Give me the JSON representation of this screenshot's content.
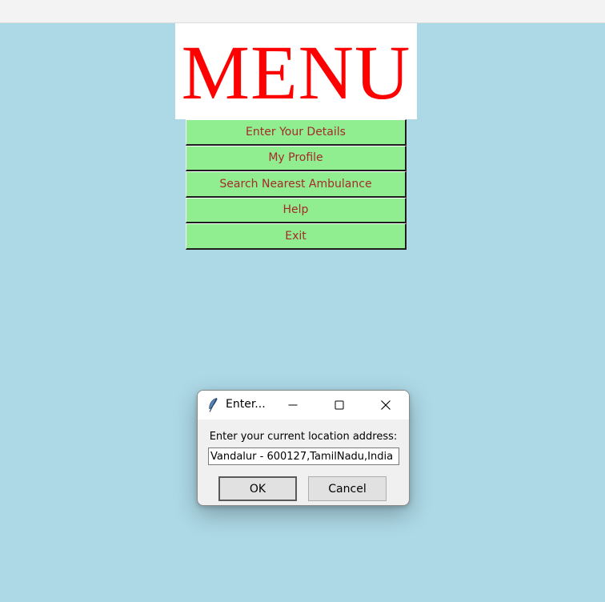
{
  "banner": {
    "title": "MENU",
    "color": "#ff0000"
  },
  "menu": {
    "button_bg": "#90ee90",
    "button_text_color": "#a52a2a",
    "items": [
      {
        "label": "Enter Your Details"
      },
      {
        "label": "My Profile"
      },
      {
        "label": "Search Nearest Ambulance"
      },
      {
        "label": "Help"
      },
      {
        "label": "Exit"
      }
    ]
  },
  "dialog": {
    "title": "Enter...",
    "icon": "feather-icon",
    "prompt": "Enter your current location address:",
    "input_value": "Vandalur - 600127,TamilNadu,India",
    "ok_label": "OK",
    "cancel_label": "Cancel"
  },
  "colors": {
    "background": "#add8e6"
  }
}
